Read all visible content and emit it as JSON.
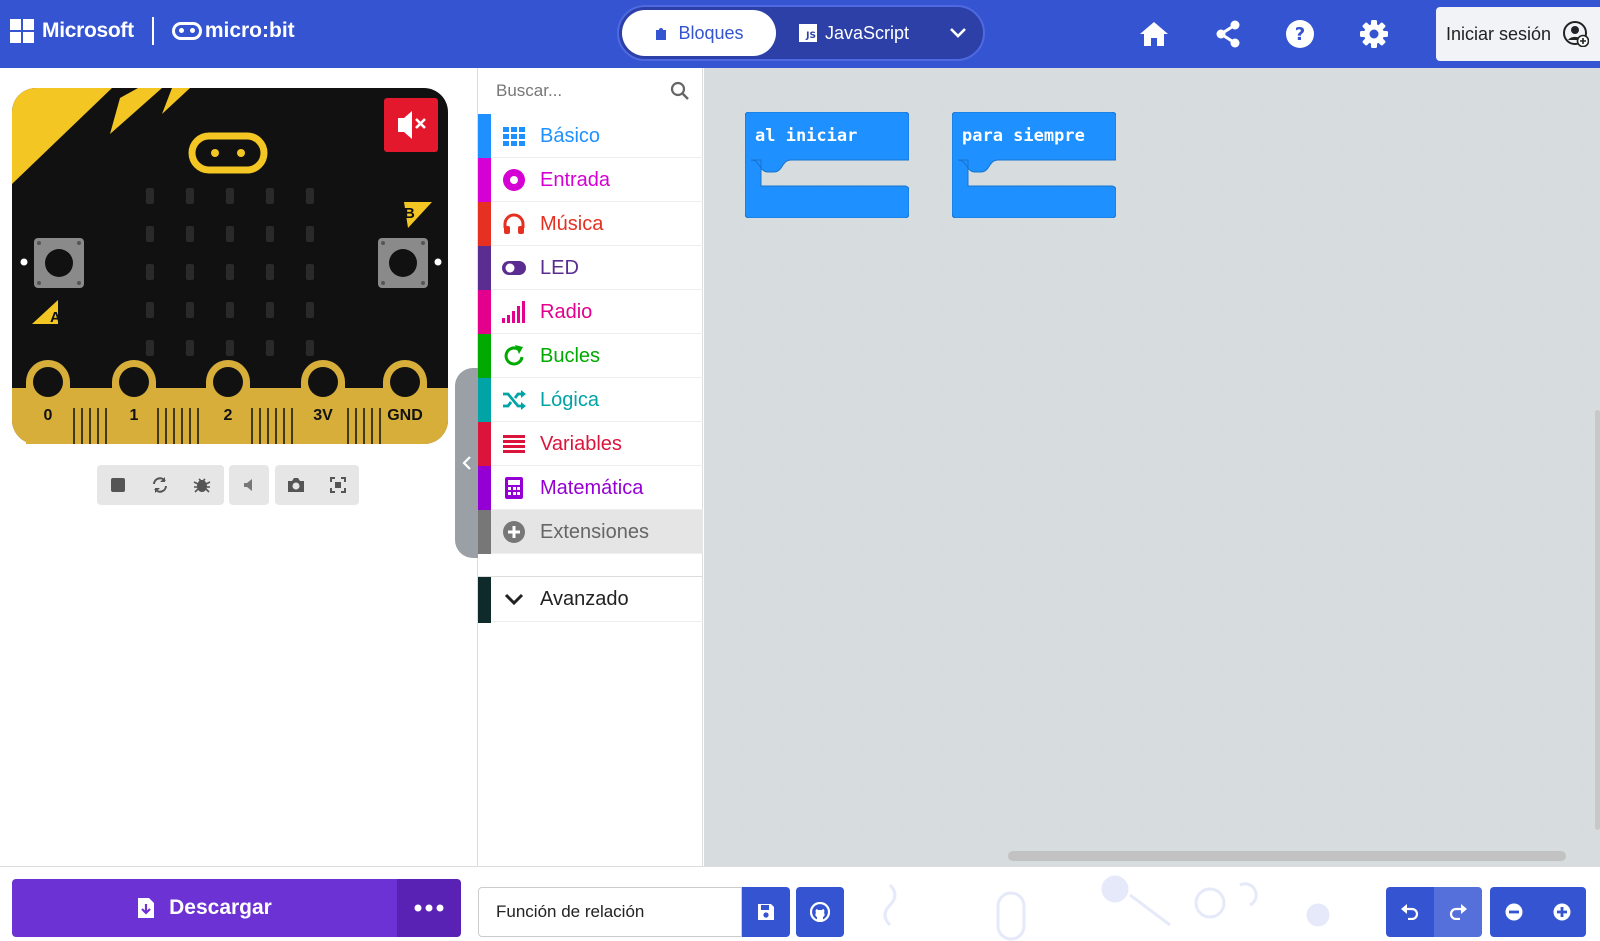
{
  "header": {
    "brand": "Microsoft",
    "product": "micro:bit",
    "tabs": [
      {
        "label": "Bloques",
        "active": true,
        "icon": "puzzle-icon"
      },
      {
        "label": "JavaScript",
        "active": false,
        "icon": "js-icon",
        "icon_text": "JS"
      }
    ],
    "icons": [
      "home-icon",
      "share-icon",
      "help-icon",
      "gear-icon"
    ],
    "signin_label": "Iniciar sesión",
    "colors": {
      "bar": "#3454d1",
      "toggle_bg": "#2c40a8"
    }
  },
  "simulator": {
    "pins": [
      "0",
      "1",
      "2",
      "3V",
      "GND"
    ],
    "button_a": "A",
    "button_b": "B",
    "mute_icon": "mute-icon",
    "toolbar_icons": [
      "stop-icon",
      "restart-icon",
      "debug-icon",
      "volume-icon",
      "screenshot-icon",
      "fullscreen-icon"
    ]
  },
  "toolbox": {
    "search_placeholder": "Buscar...",
    "categories": [
      {
        "label": "Básico",
        "color": "#1e90ff",
        "icon": "grid-icon"
      },
      {
        "label": "Entrada",
        "color": "#d400d4",
        "icon": "circle-dot-icon"
      },
      {
        "label": "Música",
        "color": "#e63022",
        "icon": "headphones-icon"
      },
      {
        "label": "LED",
        "color": "#5c2d91",
        "icon": "toggle-icon"
      },
      {
        "label": "Radio",
        "color": "#e3008c",
        "icon": "signal-bars-icon"
      },
      {
        "label": "Bucles",
        "color": "#00aa00",
        "icon": "refresh-icon"
      },
      {
        "label": "Lógica",
        "color": "#00a4a6",
        "icon": "shuffle-icon"
      },
      {
        "label": "Variables",
        "color": "#dc143c",
        "icon": "list-icon"
      },
      {
        "label": "Matemática",
        "color": "#9400d3",
        "icon": "calculator-icon"
      },
      {
        "label": "Extensiones",
        "color": "#777777",
        "icon": "plus-circle-icon"
      }
    ],
    "advanced": {
      "label": "Avanzado",
      "color": "#0e2a2a",
      "icon": "chevron-down-icon"
    }
  },
  "workspace": {
    "blocks": [
      {
        "label": "al iniciar",
        "color": "#1e90ff"
      },
      {
        "label": "para siempre",
        "color": "#1e90ff"
      }
    ]
  },
  "bottom": {
    "download_label": "Descargar",
    "project_name": "Función de relación",
    "colors": {
      "download": "#6d32d4",
      "download_more": "#5a22b4"
    }
  }
}
